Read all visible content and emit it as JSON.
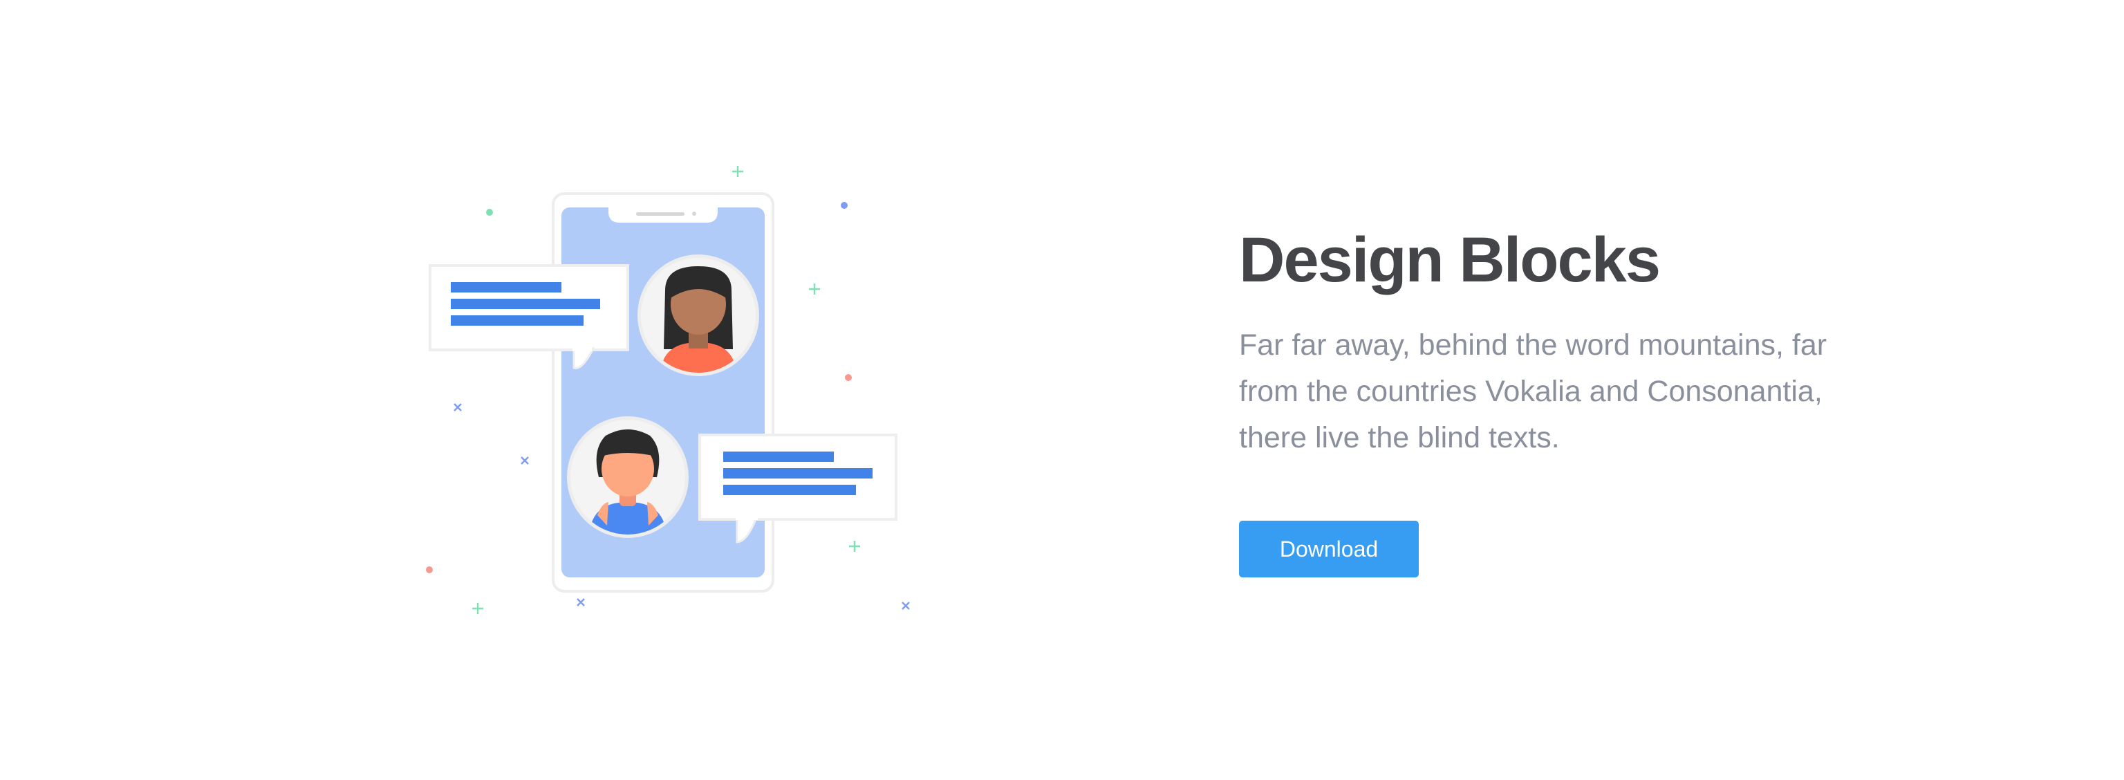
{
  "hero": {
    "title": "Design Blocks",
    "description": "Far far away, behind the word mountains, far from the countries Vokalia and Consonantia, there live the blind texts.",
    "download_label": "Download"
  },
  "illustration": {
    "subject": "phone-chat-icon",
    "colors": {
      "phone_screen": "#b1cbf8",
      "phone_frame": "#ffffff",
      "message_lines": "#4283ea",
      "avatar_bg": "#f2f2f2",
      "skin_dark": "#b67c5c",
      "skin_light": "#fda880",
      "hair": "#2b2b2b",
      "shirt_orange": "#fd6f4f",
      "shirt_blue": "#4c88f1",
      "sparkle_green": "#7fe0b4",
      "sparkle_blue": "#7e9cf0",
      "sparkle_red": "#f59a8e"
    }
  },
  "theme": {
    "accent": "#379df3",
    "title_color": "#444549",
    "text_color": "#8a8f9c"
  }
}
